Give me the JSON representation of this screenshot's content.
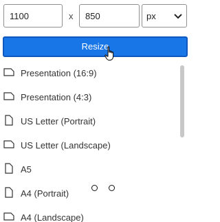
{
  "size": {
    "width": "1100",
    "height": "850",
    "separator": "x",
    "unit": "px"
  },
  "resize_label": "Resize",
  "presets": [
    {
      "label": "Presentation (16:9)",
      "icon": "landscape-page-icon"
    },
    {
      "label": "Presentation (4:3)",
      "icon": "landscape-page-icon"
    },
    {
      "label": "US Letter (Portrait)",
      "icon": "portrait-page-icon"
    },
    {
      "label": "US Letter (Landscape)",
      "icon": "landscape-page-icon"
    },
    {
      "label": "A5",
      "icon": "portrait-page-icon"
    },
    {
      "label": "A4 (Portrait)",
      "icon": "portrait-page-icon"
    },
    {
      "label": "A4 (Landscape)",
      "icon": "landscape-page-icon"
    }
  ],
  "colors": {
    "accent": "#1976e6",
    "accent_border": "#0f58c0"
  }
}
